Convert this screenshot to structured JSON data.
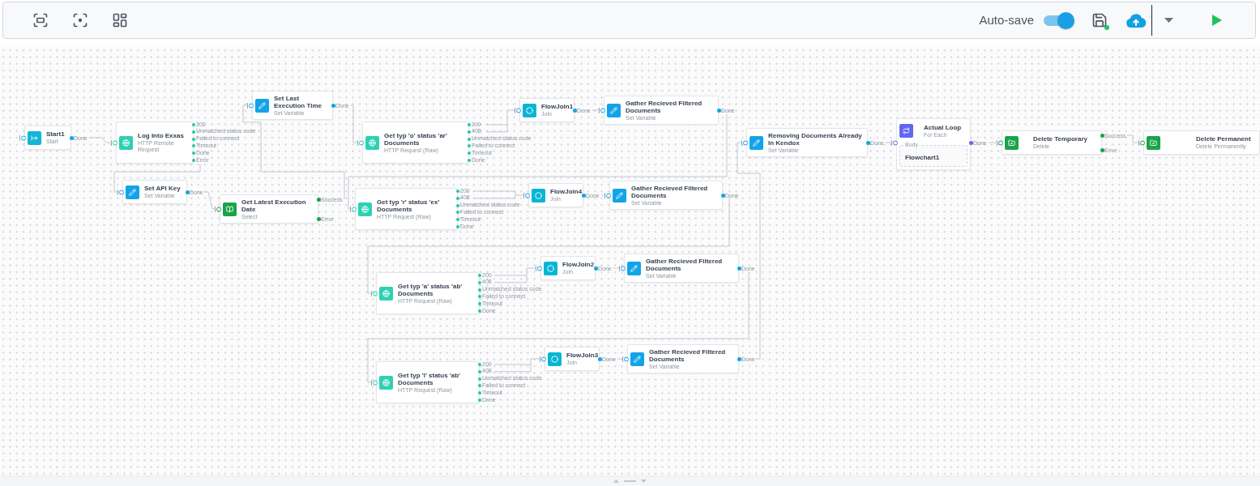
{
  "toolbar": {
    "auto_save": {
      "label": "Auto-save",
      "on": true
    },
    "save": {
      "saved": true
    }
  },
  "nodes": [
    {
      "kind": "start",
      "title": "Start1",
      "subtitle": "Start",
      "outputs": [
        "Done"
      ]
    },
    {
      "kind": "http",
      "title": "Log Into Exxas",
      "subtitle": "HTTP Remote Request",
      "outputs": [
        "200",
        "Unmatched status code",
        "Failed to connect",
        "Timeout",
        "Done",
        "Error"
      ]
    },
    {
      "kind": "set_variable",
      "title": "Set Last Execution Time",
      "subtitle": "Set Variable",
      "outputs": [
        "Done"
      ]
    },
    {
      "kind": "http",
      "title": "Get typ 'o' status 'ar' Documents",
      "subtitle": "HTTP Request (Raw)",
      "outputs": [
        "200",
        "408",
        "Unmatched status code",
        "Failed to connect",
        "Timeout",
        "Done"
      ]
    },
    {
      "kind": "join",
      "title": "FlowJoin1",
      "subtitle": "Join",
      "outputs": [
        "Done"
      ]
    },
    {
      "kind": "set_variable",
      "title": "Gather Recieved Filtered Documents",
      "subtitle": "Set Variable",
      "outputs": [
        "Done"
      ]
    },
    {
      "kind": "set_variable",
      "title": "Removing Documents Already In Kendox",
      "subtitle": "Set Variable",
      "outputs": [
        "Done"
      ]
    },
    {
      "kind": "for_each",
      "title": "Actual Loop",
      "subtitle": "For Each",
      "body": {
        "label": "Body",
        "content": "Flowchart1"
      },
      "outputs": [
        "Done"
      ]
    },
    {
      "kind": "delete",
      "title": "Delete Temporary",
      "subtitle": "Delete",
      "outputs": [
        "Success",
        "Error"
      ]
    },
    {
      "kind": "delete",
      "title": "Delete Permanent",
      "subtitle": "Delete Permanently"
    },
    {
      "kind": "set_variable",
      "title": "Set API Key",
      "subtitle": "Set Variable",
      "outputs": [
        "Done"
      ]
    },
    {
      "kind": "select",
      "title": "Get Latest Execution Date",
      "subtitle": "Select",
      "outputs": [
        "Success",
        "Error"
      ]
    },
    {
      "kind": "http",
      "title": "Get typ 'r' status 'ex' Documents",
      "subtitle": "HTTP Request (Raw)",
      "outputs": [
        "200",
        "408",
        "Unmatched status code",
        "Failed to connect",
        "Timeout",
        "Done"
      ]
    },
    {
      "kind": "join",
      "title": "FlowJoin4",
      "subtitle": "Join",
      "outputs": [
        "Done"
      ]
    },
    {
      "kind": "set_variable",
      "title": "Gather Recieved Filtered Documents",
      "subtitle": "Set Variable",
      "outputs": [
        "Done"
      ]
    },
    {
      "kind": "http",
      "title": "Get typ 'a' status 'ab' Documents",
      "subtitle": "HTTP Request (Raw)",
      "outputs": [
        "200",
        "408",
        "Unmatched status code",
        "Failed to connect",
        "Timeout",
        "Done"
      ]
    },
    {
      "kind": "join",
      "title": "FlowJoin2",
      "subtitle": "Join",
      "outputs": [
        "Done"
      ]
    },
    {
      "kind": "set_variable",
      "title": "Gather Recieved Filtered Documents",
      "subtitle": "Set Variable",
      "outputs": [
        "Done"
      ]
    },
    {
      "kind": "http",
      "title": "Get typ 'l' status 'ab' Documents",
      "subtitle": "HTTP Request (Raw)",
      "outputs": [
        "200",
        "408",
        "Unmatched status code",
        "Failed to connect",
        "Timeout",
        "Done"
      ]
    },
    {
      "kind": "join",
      "title": "FlowJoin3",
      "subtitle": "Join",
      "outputs": [
        "Done"
      ]
    },
    {
      "kind": "set_variable",
      "title": "Gather Recieved Filtered Documents",
      "subtitle": "Set Variable",
      "outputs": [
        "Done"
      ]
    }
  ]
}
